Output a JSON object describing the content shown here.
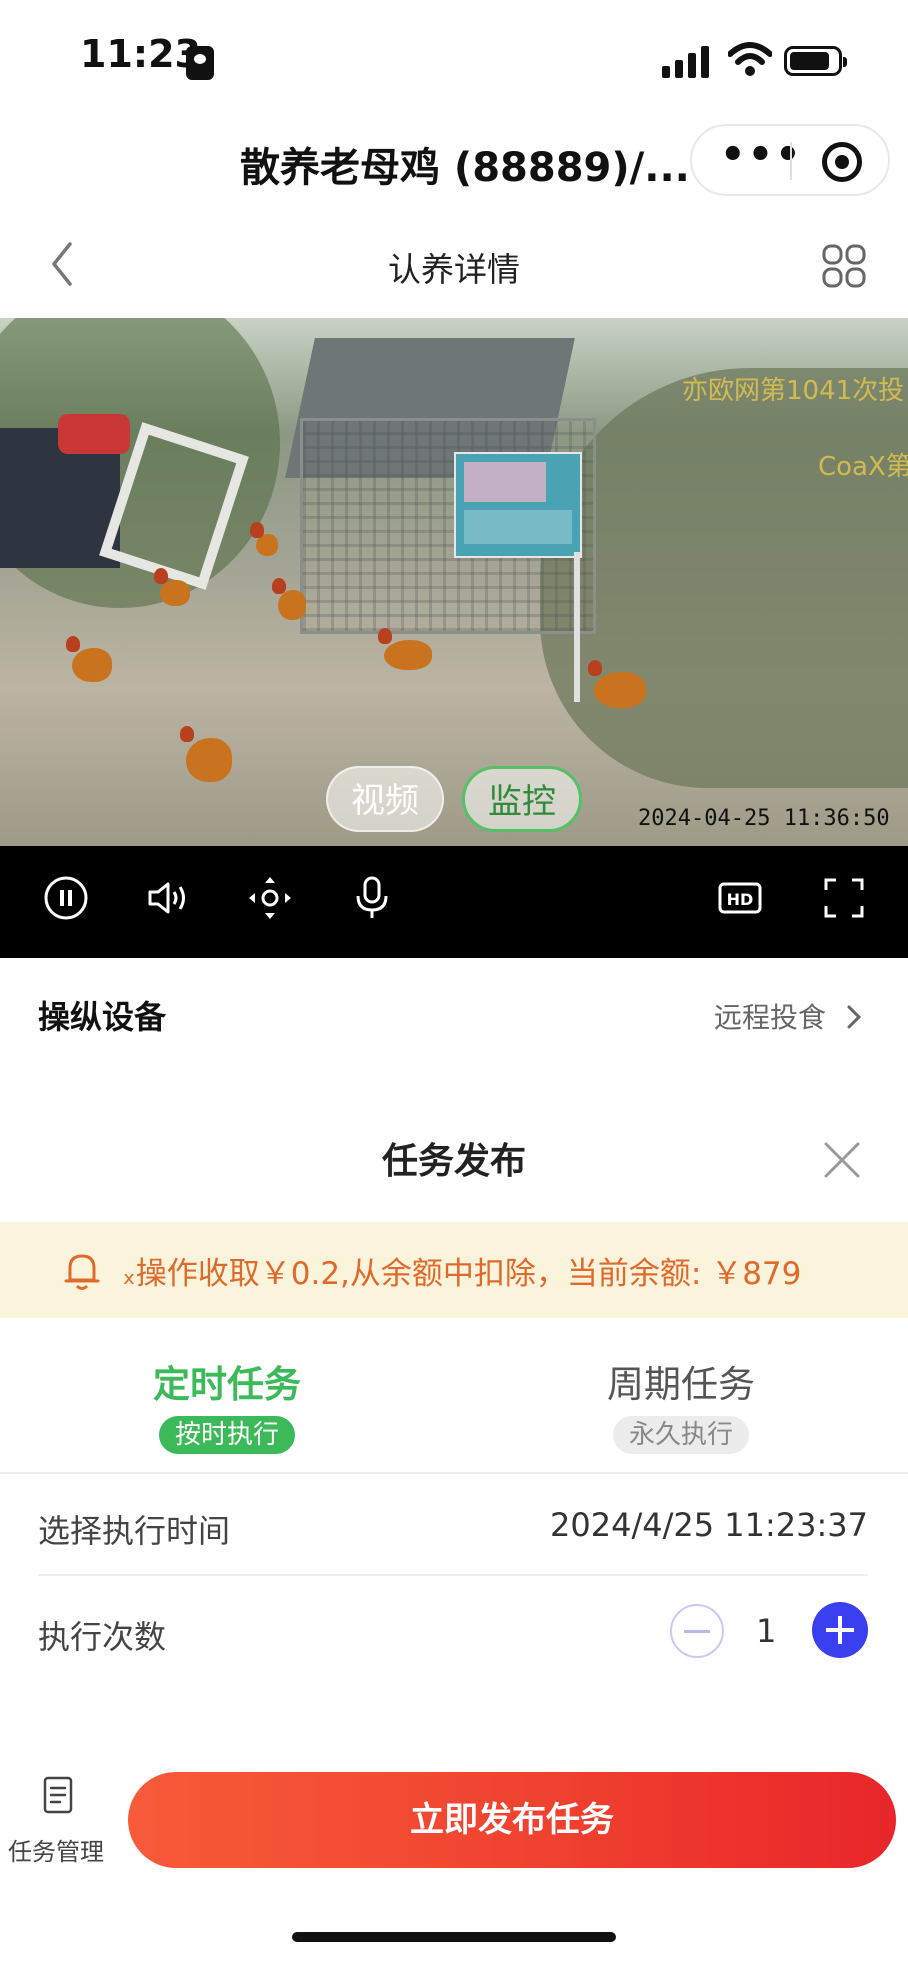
{
  "status_bar": {
    "time": "11:23",
    "icons": [
      "id-card-icon",
      "cellular-signal-icon",
      "wifi-icon",
      "battery-icon"
    ]
  },
  "miniprogram": {
    "title": "散养老母鸡 (88889)/...",
    "capsule_icons": [
      "more-icon",
      "target-icon"
    ]
  },
  "nav": {
    "title": "认养详情",
    "back_icon": "chevron-left-icon",
    "menu_icon": "grid-icon"
  },
  "video": {
    "overlay_text_1": "亦欧网第1041次投",
    "overlay_text_2": "CoaX第",
    "timestamp": "2024-04-25 11:36:50",
    "mode_tabs": [
      {
        "label": "视频",
        "active": false
      },
      {
        "label": "监控",
        "active": true
      }
    ],
    "controls": [
      "pause-icon",
      "volume-icon",
      "ptz-control-icon",
      "microphone-icon",
      "hd-icon",
      "fullscreen-icon"
    ],
    "hd_label": "HD"
  },
  "device": {
    "title": "操纵设备",
    "remote_feed_label": "远程投食"
  },
  "task_sheet": {
    "title": "任务发布",
    "notice": "ₓ操作收取￥0.2,从余额中扣除，当前余额: ￥879",
    "tabs": [
      {
        "label": "定时任务",
        "badge": "按时执行",
        "active": true
      },
      {
        "label": "周期任务",
        "badge": "永久执行",
        "active": false
      }
    ],
    "exec_time_label": "选择执行时间",
    "exec_time_value": "2024/4/25 11:23:37",
    "exec_count_label": "执行次数",
    "exec_count_value": "1"
  },
  "bottom": {
    "task_mgmt_label": "任务管理",
    "publish_label": "立即发布任务"
  },
  "colors": {
    "accent_green": "#3cb958",
    "notice_bg": "#fbf4dc",
    "notice_text": "#e06a2c",
    "plus_button": "#3a3ff0",
    "publish_gradient_start": "#f75b3a",
    "publish_gradient_end": "#e8262b"
  }
}
